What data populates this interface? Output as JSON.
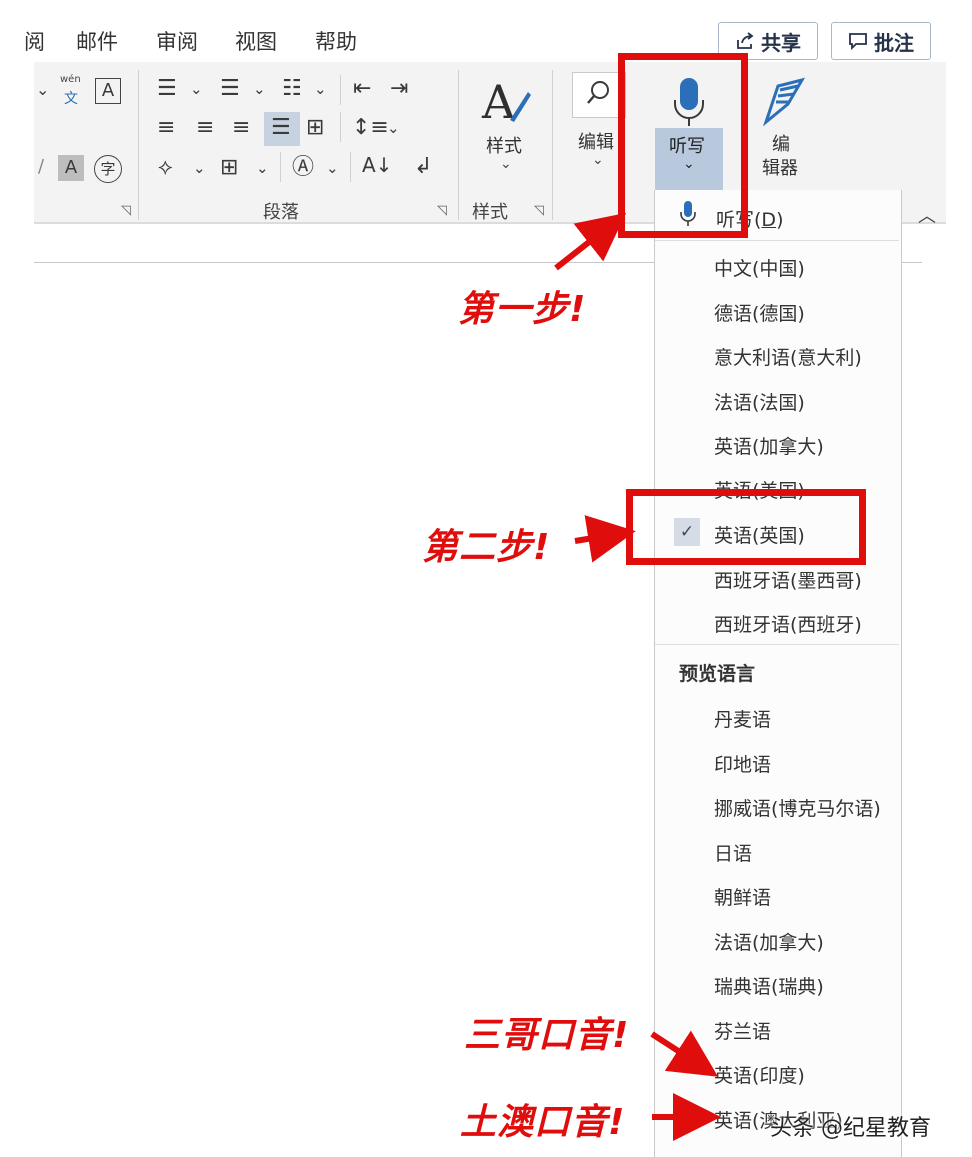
{
  "tabs": [
    "阅",
    "邮件",
    "审阅",
    "视图",
    "帮助"
  ],
  "share_button": "共享",
  "comment_button": "批注",
  "ribbon": {
    "styles_button": "样式",
    "editing_button": "编辑",
    "dictate_button": "听写",
    "editor_button_line1": "编",
    "editor_button_line2": "辑器",
    "paragraph_group": "段落",
    "styles_group": "样式",
    "phonetic_top": "wén",
    "phonetic_bottom": "文"
  },
  "dictate_menu": {
    "dictate_item": "听写(D)",
    "languages": [
      "中文(中国)",
      "德语(德国)",
      "意大利语(意大利)",
      "法语(法国)",
      "英语(加拿大)",
      "英语(美国)",
      "英语(英国)",
      "西班牙语(墨西哥)",
      "西班牙语(西班牙)"
    ],
    "selected_language": "英语(英国)",
    "preview_header": "预览语言",
    "preview_languages": [
      "丹麦语",
      "印地语",
      "挪威语(博克马尔语)",
      "日语",
      "朝鲜语",
      "法语(加拿大)",
      "瑞典语(瑞典)",
      "芬兰语",
      "英语(印度)",
      "英语(澳大利亚)"
    ]
  },
  "annotations": {
    "step1": "第一步!",
    "step2": "第二步!",
    "indian_accent": "三哥口音!",
    "aussie_accent": "土澳口音!"
  },
  "watermark": "头条 @纪星教育",
  "colors": {
    "annotation_red": "#e00d0d",
    "selected_blue": "#b8c9de"
  }
}
